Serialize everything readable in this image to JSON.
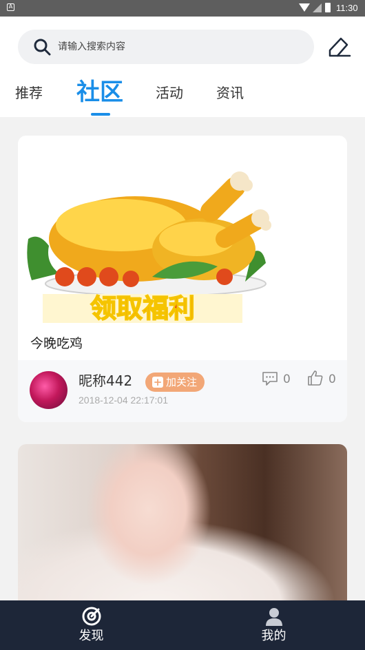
{
  "status_bar": {
    "time": "11:30",
    "left_icon": "A"
  },
  "search": {
    "placeholder": "请输入搜索内容"
  },
  "tabs": [
    {
      "label": "推荐"
    },
    {
      "label": "社区",
      "active": true
    },
    {
      "label": "活动"
    },
    {
      "label": "资讯"
    }
  ],
  "posts": [
    {
      "title": "今晚吃鸡",
      "image_text": "领取福利",
      "author": "昵称442",
      "follow_label": "加关注",
      "date": "2018-12-04 22:17:01",
      "comments": "0",
      "likes": "0"
    }
  ],
  "bottom_nav": [
    {
      "label": "发现",
      "icon": "discover-icon"
    },
    {
      "label": "我的",
      "icon": "profile-icon"
    }
  ],
  "colors": {
    "accent": "#1a8ee8",
    "follow": "#f2a777",
    "nav_bg": "#1d2638"
  }
}
